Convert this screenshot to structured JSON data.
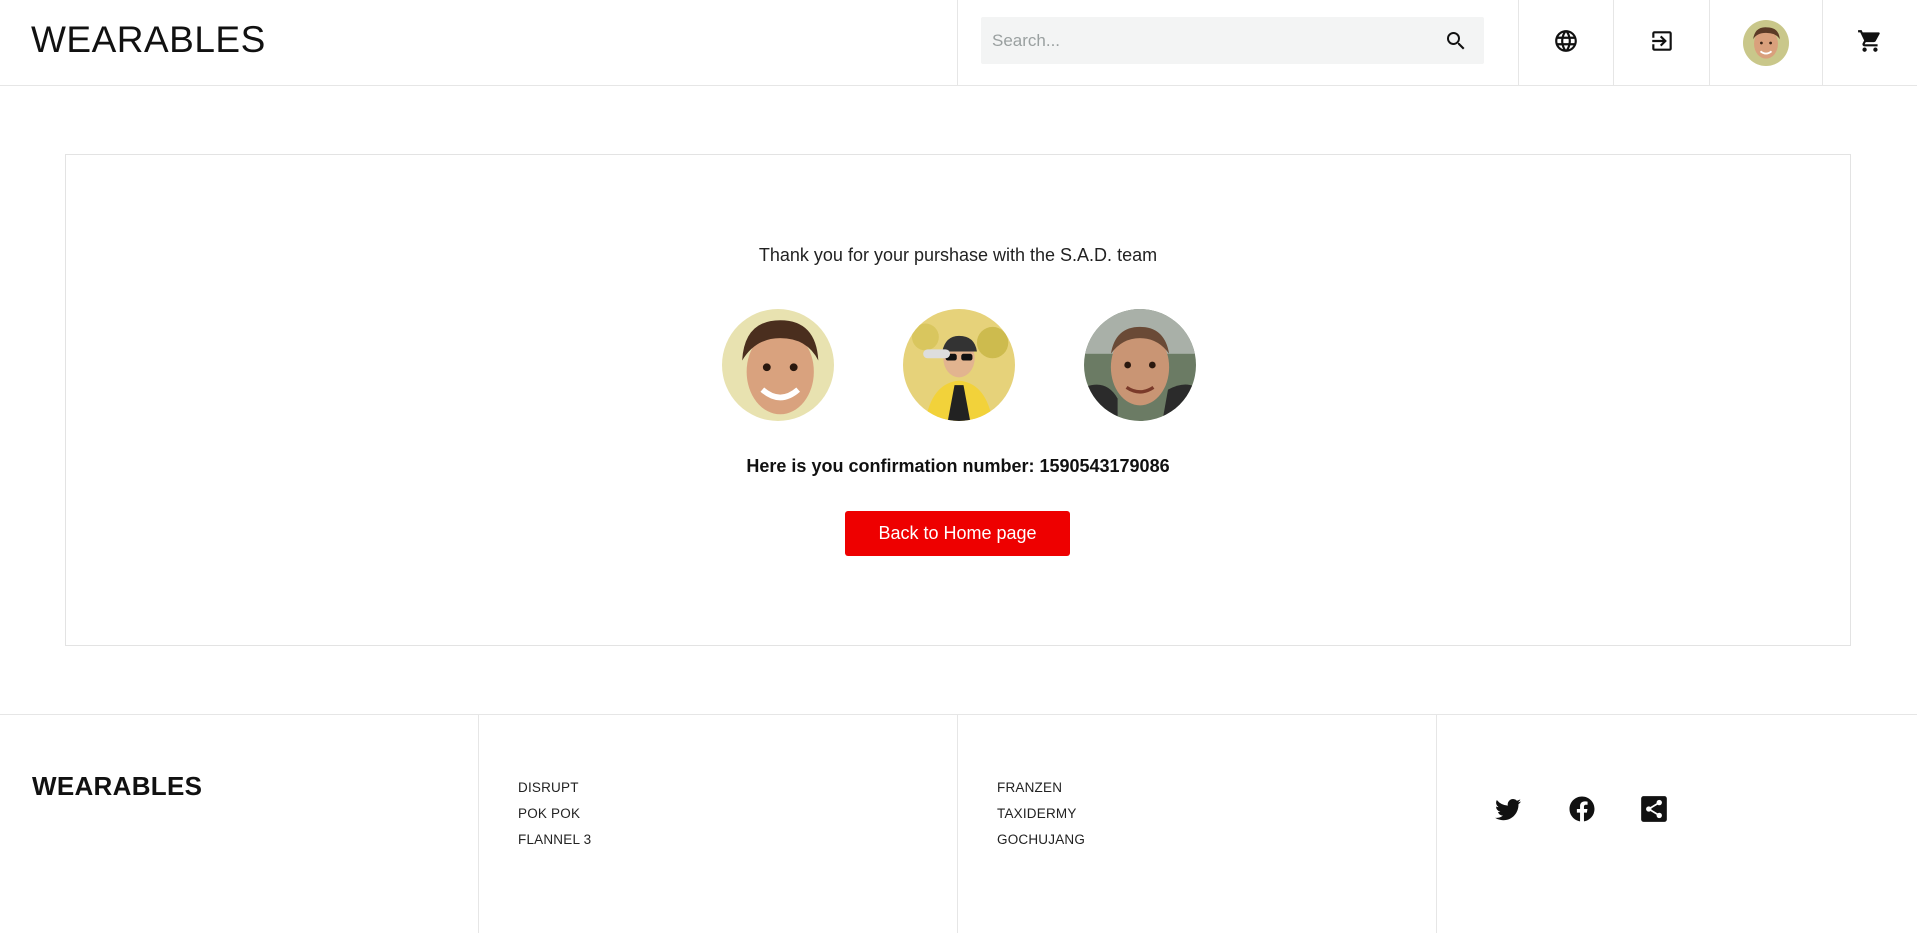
{
  "header": {
    "brand": "WEARABLES",
    "search": {
      "placeholder": "Search...",
      "value": ""
    },
    "icons": [
      "search-icon",
      "globe-icon",
      "logout-icon",
      "avatar",
      "cart-icon"
    ]
  },
  "confirmation": {
    "thanks_text": "Thank you for your purshase with the S.A.D. team",
    "confirmation_text": "Here is you confirmation number: 1590543179086",
    "back_button_label": "Back to Home page"
  },
  "footer": {
    "brand": "WEARABLES",
    "column1": [
      "DISRUPT",
      "POK POK",
      "FLANNEL 3"
    ],
    "column2": [
      "FRANZEN",
      "TAXIDERMY",
      "GOCHUJANG"
    ],
    "social": [
      "twitter-icon",
      "facebook-icon",
      "share-icon"
    ]
  },
  "colors": {
    "accent": "#ee0000",
    "search_bg": "#f3f4f4",
    "border": "#e6e6e6"
  }
}
